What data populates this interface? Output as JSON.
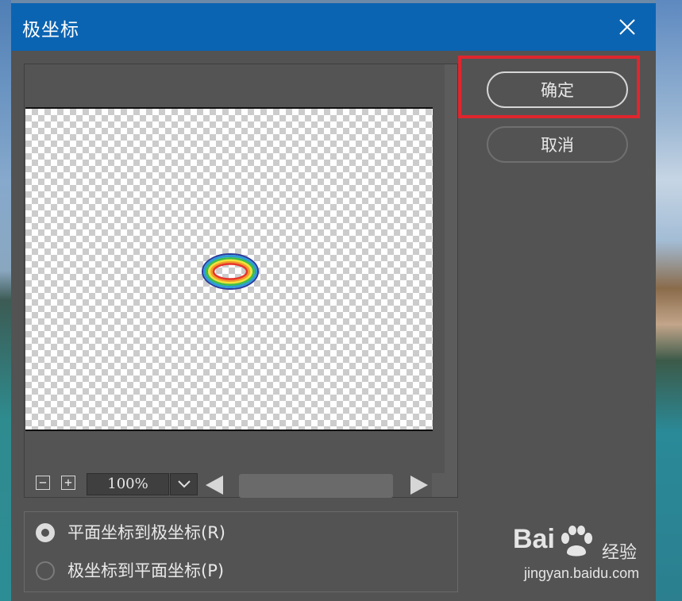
{
  "dialog": {
    "title": "极坐标",
    "close_icon": "close-icon"
  },
  "preview": {
    "zoom_out_label": "−",
    "zoom_in_label": "+",
    "zoom_value": "100%"
  },
  "buttons": {
    "ok_label": "确定",
    "cancel_label": "取消"
  },
  "options": {
    "items": [
      {
        "label": "平面坐标到极坐标(R)",
        "checked": true
      },
      {
        "label": "极坐标到平面坐标(P)",
        "checked": false
      }
    ]
  },
  "watermark": {
    "brand_left": "Bai",
    "brand_right": "经验",
    "url": "jingyan.baidu.com"
  },
  "colors": {
    "titlebar": "#0b64b2",
    "dialog_bg": "#535353",
    "highlight": "#e0262e"
  }
}
